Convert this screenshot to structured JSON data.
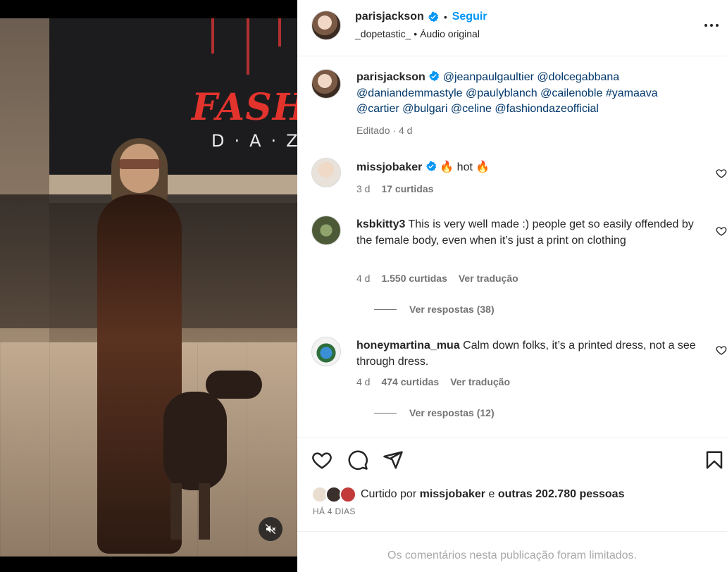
{
  "media": {
    "sign_text": "FASHIO",
    "sign_subtext": "D·A·Z·E",
    "mute_icon": "speaker-muted-icon"
  },
  "header": {
    "username": "parisjackson",
    "verified_icon": "verified-badge-icon",
    "separator": "•",
    "follow_label": "Seguir",
    "audio_user": "_dopetastic_",
    "audio_separator": "•",
    "audio_label": "Áudio original",
    "more_icon": "more-options-icon"
  },
  "caption": {
    "username": "parisjackson",
    "mentions_line1": "@jeanpaulgaultier @dolcegabbana",
    "mentions_line2": "@daniandemmastyle @paulyblanch @cailenoble #yamaava",
    "mentions_line3": "@cartier @bulgari @celine @fashiondazeofficial",
    "edited": "Editado",
    "meta_separator": "·",
    "time": "4 d"
  },
  "comments": [
    {
      "username": "missjobaker",
      "text_hot": "hot",
      "emoji": "🔥",
      "time": "3 d",
      "likes": "17 curtidas"
    },
    {
      "username": "ksbkitty3",
      "text": "This is very well made :) people get so easily offended by the female body, even when it’s just a print on clothing",
      "time": "4 d",
      "likes": "1.550 curtidas",
      "translate": "Ver tradução",
      "replies": "Ver respostas (38)"
    },
    {
      "username": "honeymartina_mua",
      "text": "Calm down folks, it’s a printed dress, not a see through dress.",
      "time": "4 d",
      "likes": "474 curtidas",
      "translate": "Ver tradução",
      "replies": "Ver respostas (12)"
    }
  ],
  "actions": {
    "like_icon": "heart-icon",
    "comment_icon": "comment-icon",
    "share_icon": "share-icon",
    "save_icon": "bookmark-icon"
  },
  "likes": {
    "prefix": "Curtido por",
    "user": "missjobaker",
    "conj": "e",
    "others": "outras 202.780 pessoas"
  },
  "date": "HÁ 4 DIAS",
  "limited_notice": "Os comentários nesta publicação foram limitados."
}
